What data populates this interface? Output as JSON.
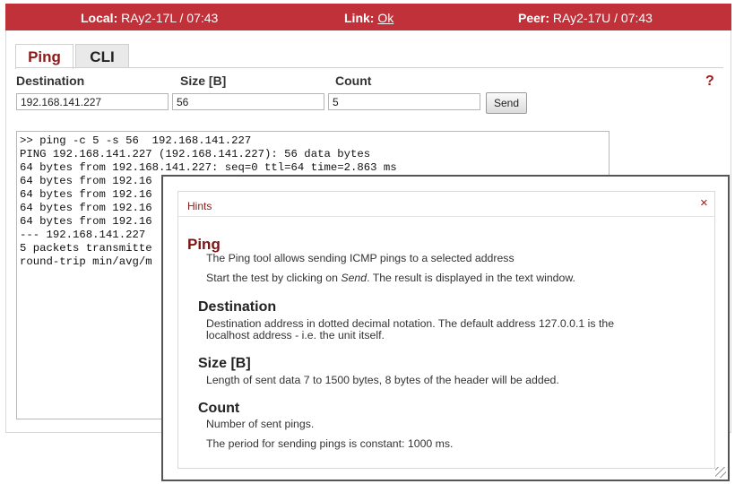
{
  "status": {
    "local_label": "Local:",
    "local_value": "RAy2-17L / 07:43",
    "link_label": "Link:",
    "link_value": "Ok",
    "peer_label": "Peer:",
    "peer_value": "RAy2-17U / 07:43"
  },
  "tabs": [
    {
      "label": "Ping",
      "active": true
    },
    {
      "label": "CLI",
      "active": false
    }
  ],
  "form": {
    "destination_label": "Destination",
    "destination_value": "192.168.141.227",
    "size_label": "Size [B]",
    "size_value": "56",
    "count_label": "Count",
    "count_value": "5",
    "send_label": "Send",
    "help_label": "?"
  },
  "output": {
    "lines": [
      ">> ping -c 5 -s 56  192.168.141.227",
      "PING 192.168.141.227 (192.168.141.227): 56 data bytes",
      "64 bytes from 192.168.141.227: seq=0 ttl=64 time=2.863 ms",
      "64 bytes from 192.16",
      "64 bytes from 192.16",
      "64 bytes from 192.16",
      "64 bytes from 192.16",
      "",
      "--- 192.168.141.227",
      "5 packets transmitte",
      "round-trip min/avg/m"
    ]
  },
  "hints": {
    "title": "Hints",
    "close_symbol": "×",
    "heading": "Ping",
    "intro1": "The Ping tool allows sending ICMP pings to a selected address",
    "intro2_before": "Start the test by clicking on ",
    "intro2_em": "Send",
    "intro2_after": ". The result is displayed in the text window.",
    "destination_heading": "Destination",
    "destination_text": "Destination address in dotted decimal notation. The default address 127.0.0.1 is the localhost address - i.e. the unit itself.",
    "size_heading": "Size [B]",
    "size_text": "Length of sent data 7 to 1500 bytes, 8 bytes of the header will be added.",
    "count_heading": "Count",
    "count_text1": "Number of sent pings.",
    "count_text2": "The period for sending pings is constant: 1000 ms."
  },
  "colors": {
    "status_bar": "#c0313a",
    "accent": "#8b1a1a"
  }
}
